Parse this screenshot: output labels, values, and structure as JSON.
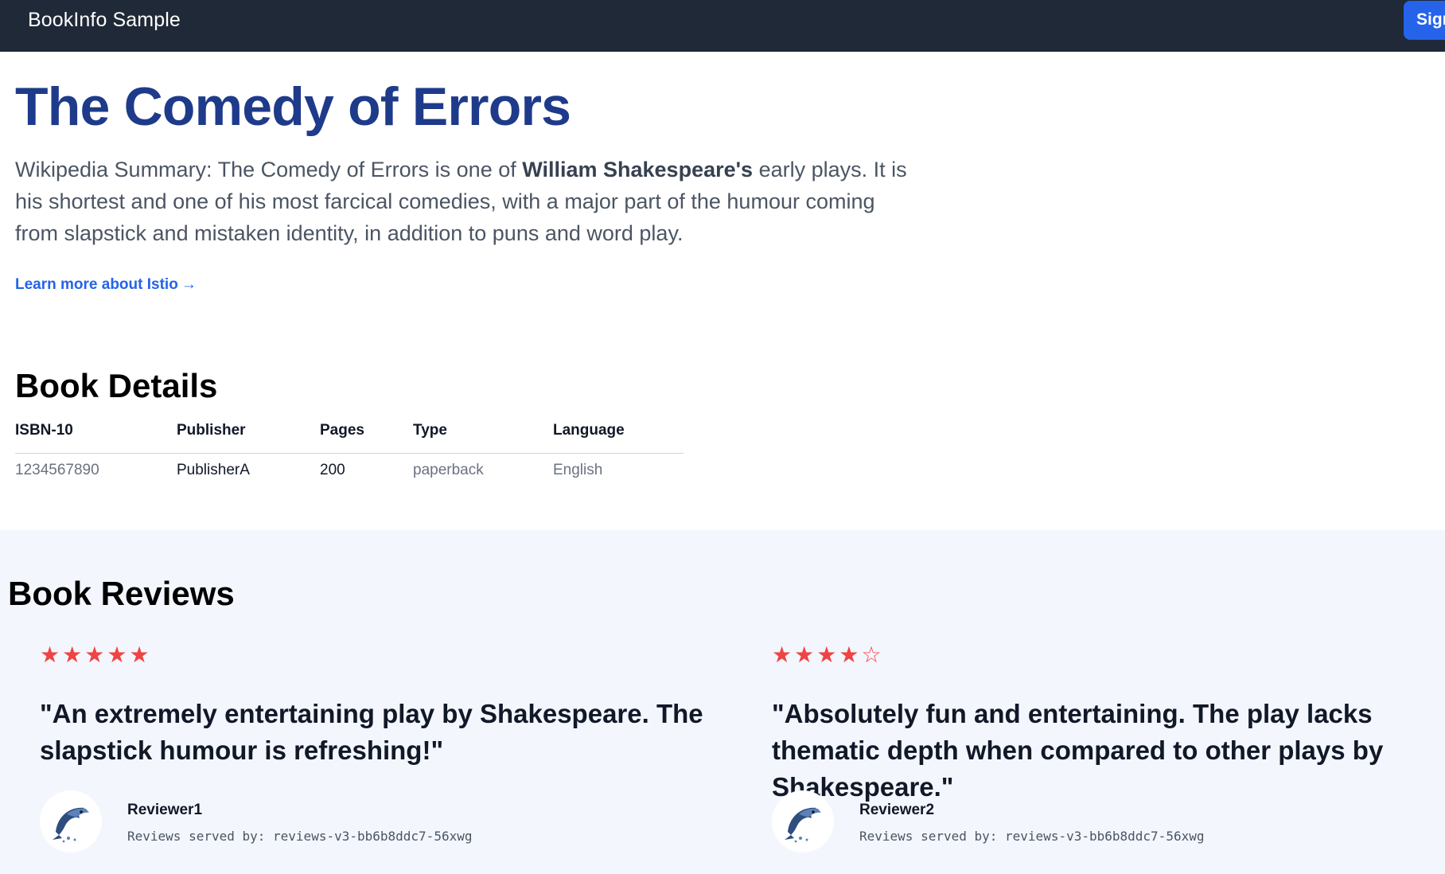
{
  "nav": {
    "brand": "BookInfo Sample",
    "signin_label": "Sign in"
  },
  "book": {
    "title": "The Comedy of Errors",
    "summary_prefix": "Wikipedia Summary: The Comedy of Errors is one of ",
    "summary_bold": "William Shakespeare's",
    "summary_suffix": " early plays. It is his shortest and one of his most farcical comedies, with a major part of the humour coming from slapstick and mistaken identity, in addition to puns and word play.",
    "learn_more": "Learn more about Istio",
    "learn_more_arrow": "→"
  },
  "details": {
    "heading": "Book Details",
    "columns": [
      "ISBN-10",
      "Publisher",
      "Pages",
      "Type",
      "Language"
    ],
    "row": [
      "1234567890",
      "PublisherA",
      "200",
      "paperback",
      "English"
    ]
  },
  "reviews": {
    "heading": "Book Reviews",
    "star_color": "#ef4444",
    "items": [
      {
        "rating": 5,
        "max_rating": 5,
        "stars": [
          "★",
          "★",
          "★",
          "★",
          "★"
        ],
        "text": "\"An extremely entertaining play by Shakespeare. The slapstick humour is refreshing!\"",
        "reviewer": "Reviewer1",
        "served_by": "Reviews served by: reviews-v3-bb6b8ddc7-56xwg",
        "avatar_icon": "dolphin-icon"
      },
      {
        "rating": 4,
        "max_rating": 5,
        "stars": [
          "★",
          "★",
          "★",
          "★",
          "☆"
        ],
        "text": "\"Absolutely fun and entertaining. The play lacks thematic depth when compared to other plays by Shakespeare.\"",
        "reviewer": "Reviewer2",
        "served_by": "Reviews served by: reviews-v3-bb6b8ddc7-56xwg",
        "avatar_icon": "dolphin-icon"
      }
    ]
  },
  "colors": {
    "navbar": "#1f2937",
    "title": "#1e3a8a",
    "link": "#2563eb",
    "button": "#2563eb",
    "reviews_bg": "#f3f6fd"
  }
}
